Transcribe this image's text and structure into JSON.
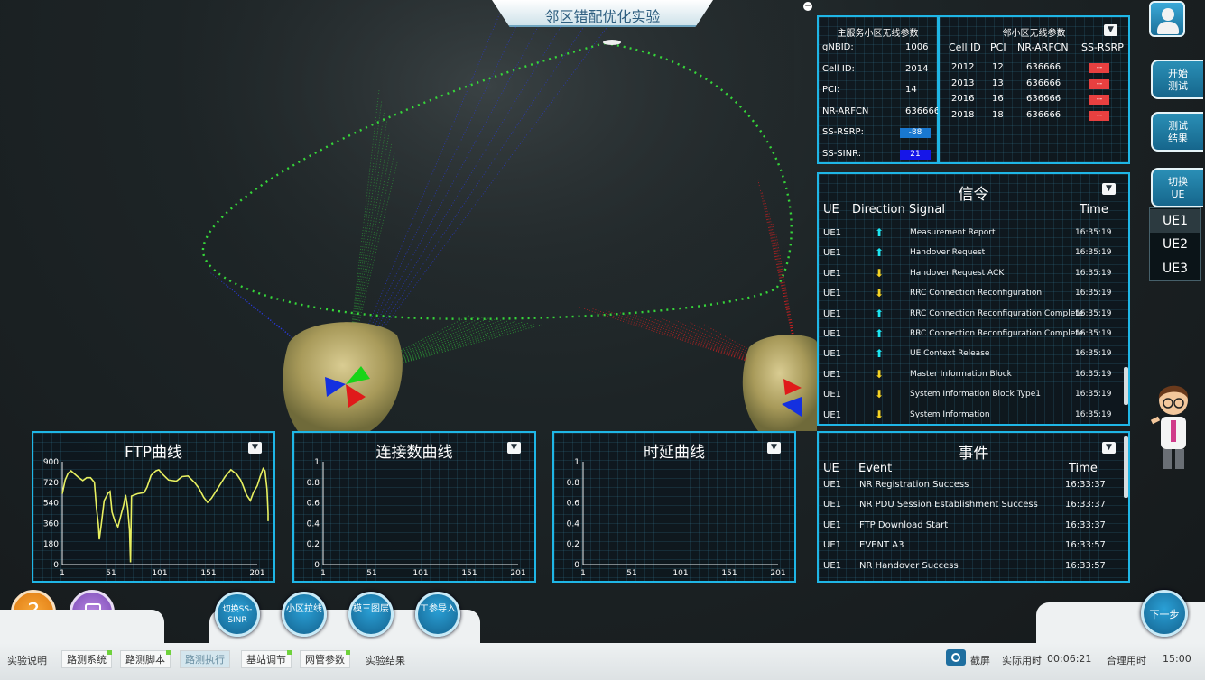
{
  "app": {
    "title": "邻区错配优化实验"
  },
  "serving": {
    "title": "主服务小区无线参数",
    "params": [
      {
        "label": "gNBID:",
        "value": "1006"
      },
      {
        "label": "Cell ID:",
        "value": "2014"
      },
      {
        "label": "PCI:",
        "value": "14"
      },
      {
        "label": "NR-ARFCN",
        "value": "636666"
      },
      {
        "label": "SS-RSRP:",
        "value": "-88",
        "color": "#1978d0"
      },
      {
        "label": "SS-SINR:",
        "value": "21",
        "color": "#1616e8"
      }
    ]
  },
  "neighbor": {
    "title": "邻小区无线参数",
    "cols": [
      "Cell ID",
      "PCI",
      "NR-ARFCN",
      "SS-RSRP"
    ],
    "rows": [
      {
        "cellid": "2012",
        "pci": "12",
        "arfcn": "636666",
        "rsrp": "--"
      },
      {
        "cellid": "2013",
        "pci": "13",
        "arfcn": "636666",
        "rsrp": "--"
      },
      {
        "cellid": "2016",
        "pci": "16",
        "arfcn": "636666",
        "rsrp": "--"
      },
      {
        "cellid": "2018",
        "pci": "18",
        "arfcn": "636666",
        "rsrp": "--"
      }
    ]
  },
  "signaling": {
    "title": "信令",
    "cols": [
      "UE",
      "Direction",
      "Signal",
      "Time"
    ],
    "rows": [
      {
        "ue": "UE1",
        "dir": "up",
        "signal": "Measurement Report",
        "time": "16:35:19"
      },
      {
        "ue": "UE1",
        "dir": "up",
        "signal": "Handover Request",
        "time": "16:35:19"
      },
      {
        "ue": "UE1",
        "dir": "down",
        "signal": "Handover Request ACK",
        "time": "16:35:19"
      },
      {
        "ue": "UE1",
        "dir": "down",
        "signal": "RRC Connection Reconfiguration",
        "time": "16:35:19"
      },
      {
        "ue": "UE1",
        "dir": "up",
        "signal": "RRC Connection Reconfiguration Complete",
        "time": "16:35:19"
      },
      {
        "ue": "UE1",
        "dir": "up",
        "signal": "RRC Connection Reconfiguration Complete",
        "time": "16:35:19"
      },
      {
        "ue": "UE1",
        "dir": "up",
        "signal": "UE Context Release",
        "time": "16:35:19"
      },
      {
        "ue": "UE1",
        "dir": "down",
        "signal": "Master Information Block",
        "time": "16:35:19"
      },
      {
        "ue": "UE1",
        "dir": "down",
        "signal": "System Information Block Type1",
        "time": "16:35:19"
      },
      {
        "ue": "UE1",
        "dir": "down",
        "signal": "System Information",
        "time": "16:35:19"
      }
    ]
  },
  "events": {
    "title": "事件",
    "cols": [
      "UE",
      "Event",
      "Time"
    ],
    "rows": [
      {
        "ue": "UE1",
        "event": "NR Registration Success",
        "time": "16:33:37"
      },
      {
        "ue": "UE1",
        "event": "NR PDU Session Establishment Success",
        "time": "16:33:37"
      },
      {
        "ue": "UE1",
        "event": "FTP Download Start",
        "time": "16:33:37"
      },
      {
        "ue": "UE1",
        "event": "EVENT A3",
        "time": "16:33:57"
      },
      {
        "ue": "UE1",
        "event": "NR Handover Success",
        "time": "16:33:57"
      }
    ]
  },
  "right_buttons": {
    "start": "开始测试",
    "result": "测试结果",
    "switch_ue": "切换UE",
    "ue_options": [
      "UE1",
      "UE2",
      "UE3"
    ]
  },
  "tool_buttons": [
    {
      "label": "切换SS-SINR"
    },
    {
      "label": "小区拉线"
    },
    {
      "label": "模三图层"
    },
    {
      "label": "工参导入"
    }
  ],
  "next_label": "下一步",
  "tabs": [
    "实验说明",
    "路测系统",
    "路测脚本",
    "路测执行",
    "基站调节",
    "网管参数",
    "实验结果"
  ],
  "status": {
    "screenshot": "截屏",
    "actual_label": "实际用时",
    "actual_value": "00:06:21",
    "reasonable_label": "合理用时",
    "reasonable_value": "15:00"
  },
  "colors": {
    "accent": "#1fb6e6",
    "curve": "#e8f060",
    "rsrp_badge": "#e84040"
  },
  "chart_data": [
    {
      "type": "line",
      "title": "FTP曲线",
      "xticks": [
        "1",
        "51",
        "101",
        "151",
        "201"
      ],
      "yticks": [
        "0",
        "180",
        "360",
        "540",
        "720",
        "900"
      ],
      "ylim": [
        0,
        900
      ],
      "xlim": [
        1,
        201
      ],
      "series": [
        {
          "values": [
            [
              1,
              620
            ],
            [
              4,
              740
            ],
            [
              7,
              800
            ],
            [
              10,
              820
            ],
            [
              14,
              790
            ],
            [
              18,
              760
            ],
            [
              22,
              735
            ],
            [
              26,
              760
            ],
            [
              30,
              760
            ],
            [
              34,
              720
            ],
            [
              36,
              500
            ],
            [
              38,
              350
            ],
            [
              39,
              220
            ],
            [
              41,
              350
            ],
            [
              44,
              560
            ],
            [
              48,
              625
            ],
            [
              50,
              640
            ],
            [
              52,
              460
            ],
            [
              55,
              380
            ],
            [
              58,
              330
            ],
            [
              60,
              390
            ],
            [
              62,
              460
            ],
            [
              64,
              520
            ],
            [
              66,
              610
            ],
            [
              68,
              500
            ],
            [
              70,
              300
            ],
            [
              71,
              20
            ],
            [
              72,
              600
            ],
            [
              78,
              620
            ],
            [
              85,
              630
            ],
            [
              88,
              680
            ],
            [
              92,
              780
            ],
            [
              97,
              820
            ],
            [
              100,
              830
            ],
            [
              104,
              790
            ],
            [
              110,
              740
            ],
            [
              118,
              730
            ],
            [
              124,
              770
            ],
            [
              130,
              775
            ],
            [
              137,
              715
            ],
            [
              141,
              670
            ],
            [
              146,
              590
            ],
            [
              150,
              545
            ],
            [
              154,
              580
            ],
            [
              160,
              660
            ],
            [
              168,
              770
            ],
            [
              174,
              830
            ],
            [
              180,
              790
            ],
            [
              184,
              740
            ],
            [
              186,
              700
            ],
            [
              190,
              610
            ],
            [
              194,
              560
            ],
            [
              197,
              630
            ],
            [
              201,
              690
            ],
            [
              204,
              770
            ],
            [
              207,
              840
            ],
            [
              209,
              820
            ],
            [
              211,
              660
            ],
            [
              213,
              450
            ],
            [
              215,
              380
            ]
          ]
        }
      ]
    },
    {
      "type": "line",
      "title": "连接数曲线",
      "xticks": [
        "1",
        "51",
        "101",
        "151",
        "201"
      ],
      "yticks": [
        "0",
        "0.2",
        "0.4",
        "0.6",
        "0.8",
        "1"
      ],
      "ylim": [
        0,
        1
      ],
      "xlim": [
        1,
        201
      ],
      "series": []
    },
    {
      "type": "line",
      "title": "时延曲线",
      "xticks": [
        "1",
        "51",
        "101",
        "151",
        "201"
      ],
      "yticks": [
        "0",
        "0.2",
        "0.4",
        "0.6",
        "0.8",
        "1"
      ],
      "ylim": [
        0,
        1
      ],
      "xlim": [
        1,
        201
      ],
      "series": []
    }
  ]
}
